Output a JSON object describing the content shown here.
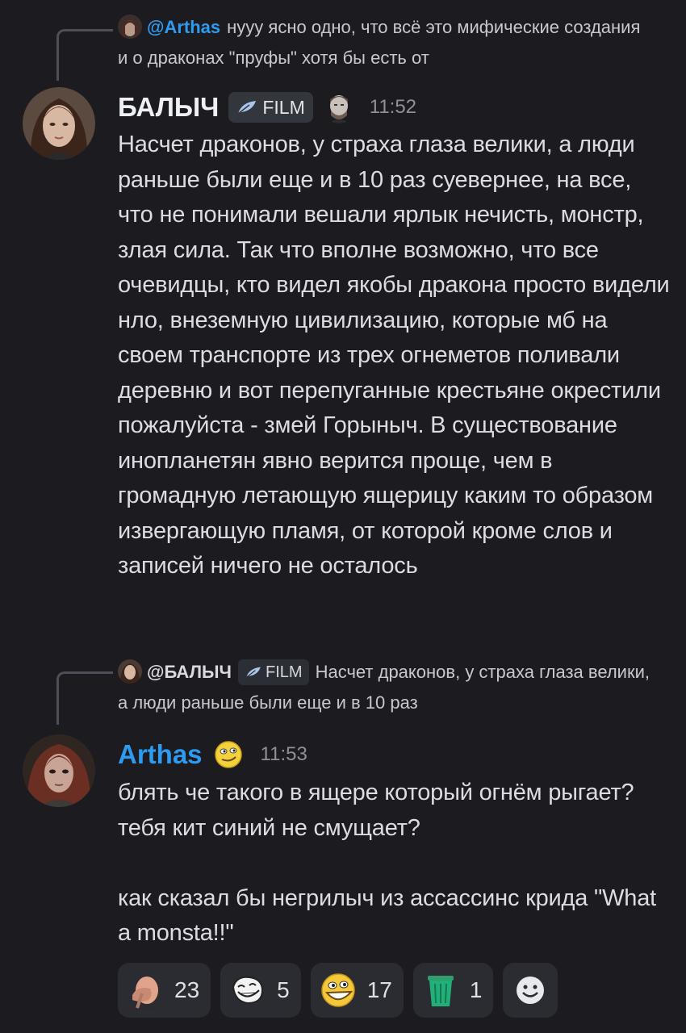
{
  "messages": [
    {
      "reply": {
        "author": "@Arthas",
        "text": "нууу ясно одно, что всё это мифические создания и о драконах \"пруфы\" хотя бы есть от"
      },
      "author": "БАЛЫЧ",
      "tag": "FILM",
      "time": "11:52",
      "text": "Насчет драконов, у страха глаза велики, а люди раньше были еще и в 10 раз суевернее, на все, что не понимали вешали ярлык нечисть, монстр, злая сила. Так что вполне возможно, что все очевидцы, кто видел якобы дракона просто видели нло, внеземную цивилизацию, которые мб на своем транспорте из трех огнеметов поливали деревню и вот перепуганные крестьяне окрестили пожалуйста - змей Горыныч. В существование инопланетян явно верится проще, чем в громадную летающую ящерицу каким то образом извергающую пламя, от которой кроме слов и записей ничего не осталось"
    },
    {
      "reply": {
        "author": "@БАЛЫЧ",
        "tag": "FILM",
        "text": "Насчет драконов, у страха глаза велики, а люди раньше были еще и в 10 раз"
      },
      "author": "Arthas",
      "time": "11:53",
      "text": "блять че такого в ящере который огнём рыгает? тебя кит синий не смущает?\n\nкак сказал бы негрилыч из ассассинс крида \"What a monsta!!\""
    }
  ],
  "reactions": [
    {
      "icon": "facepalm-emoji",
      "count": "23"
    },
    {
      "icon": "trollface-emoji",
      "count": "5"
    },
    {
      "icon": "grinning-face-emoji",
      "count": "17"
    },
    {
      "icon": "trash-bin-emoji",
      "count": "1"
    }
  ],
  "colors": {
    "background": "#1b1b20",
    "blue_name": "#2f9bf0",
    "reaction_bg": "#2b2c31"
  }
}
